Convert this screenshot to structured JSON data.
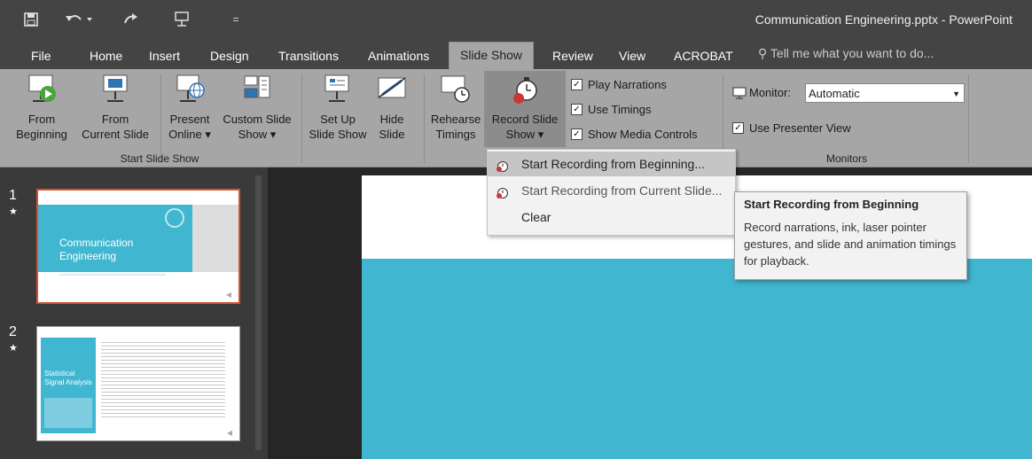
{
  "window": {
    "title": "Communication Engineering.pptx - PowerPoint"
  },
  "qat": {
    "save_icon": "save-icon",
    "undo_icon": "undo-icon",
    "redo_icon": "redo-icon",
    "present_icon": "present-icon",
    "customize_icon": "customize-icon"
  },
  "tabs": [
    "File",
    "Home",
    "Insert",
    "Design",
    "Transitions",
    "Animations",
    "Slide Show",
    "Review",
    "View",
    "ACROBAT"
  ],
  "active_tab": "Slide Show",
  "tell_me": {
    "placeholder": "Tell me what you want to do..."
  },
  "ribbon": {
    "start_slide_show": {
      "label": "Start Slide Show",
      "from_beginning": [
        "From",
        "Beginning"
      ],
      "from_current": [
        "From",
        "Current Slide"
      ],
      "present_online": [
        "Present",
        "Online ▾"
      ],
      "custom_slide_show": [
        "Custom Slide",
        "Show ▾"
      ]
    },
    "set_up": {
      "set_up_slide_show": [
        "Set Up",
        "Slide Show"
      ],
      "hide_slide": [
        "Hide",
        "Slide"
      ],
      "rehearse_timings": [
        "Rehearse",
        "Timings"
      ],
      "record_slide_show": [
        "Record Slide",
        "Show ▾"
      ],
      "play_narrations": "Play Narrations",
      "use_timings": "Use Timings",
      "show_media_controls": "Show Media Controls"
    },
    "monitors": {
      "label": "Monitors",
      "monitor_label": "Monitor:",
      "monitor_value": "Automatic",
      "use_presenter_view": "Use Presenter View"
    }
  },
  "menu": {
    "items": [
      "Start Recording from Beginning...",
      "Start Recording from Current Slide...",
      "Clear"
    ]
  },
  "tooltip": {
    "title": "Start Recording from Beginning",
    "body": "Record narrations, ink, laser pointer gestures, and slide and animation timings for playback."
  },
  "slides": [
    {
      "number": "1",
      "star": "★",
      "title": [
        "Communication",
        "Engineering"
      ]
    },
    {
      "number": "2",
      "star": "★",
      "title": [
        "Statistical",
        "Signal Analysis"
      ]
    }
  ],
  "colors": {
    "accent": "#41b6d0",
    "selection": "#d35230"
  }
}
